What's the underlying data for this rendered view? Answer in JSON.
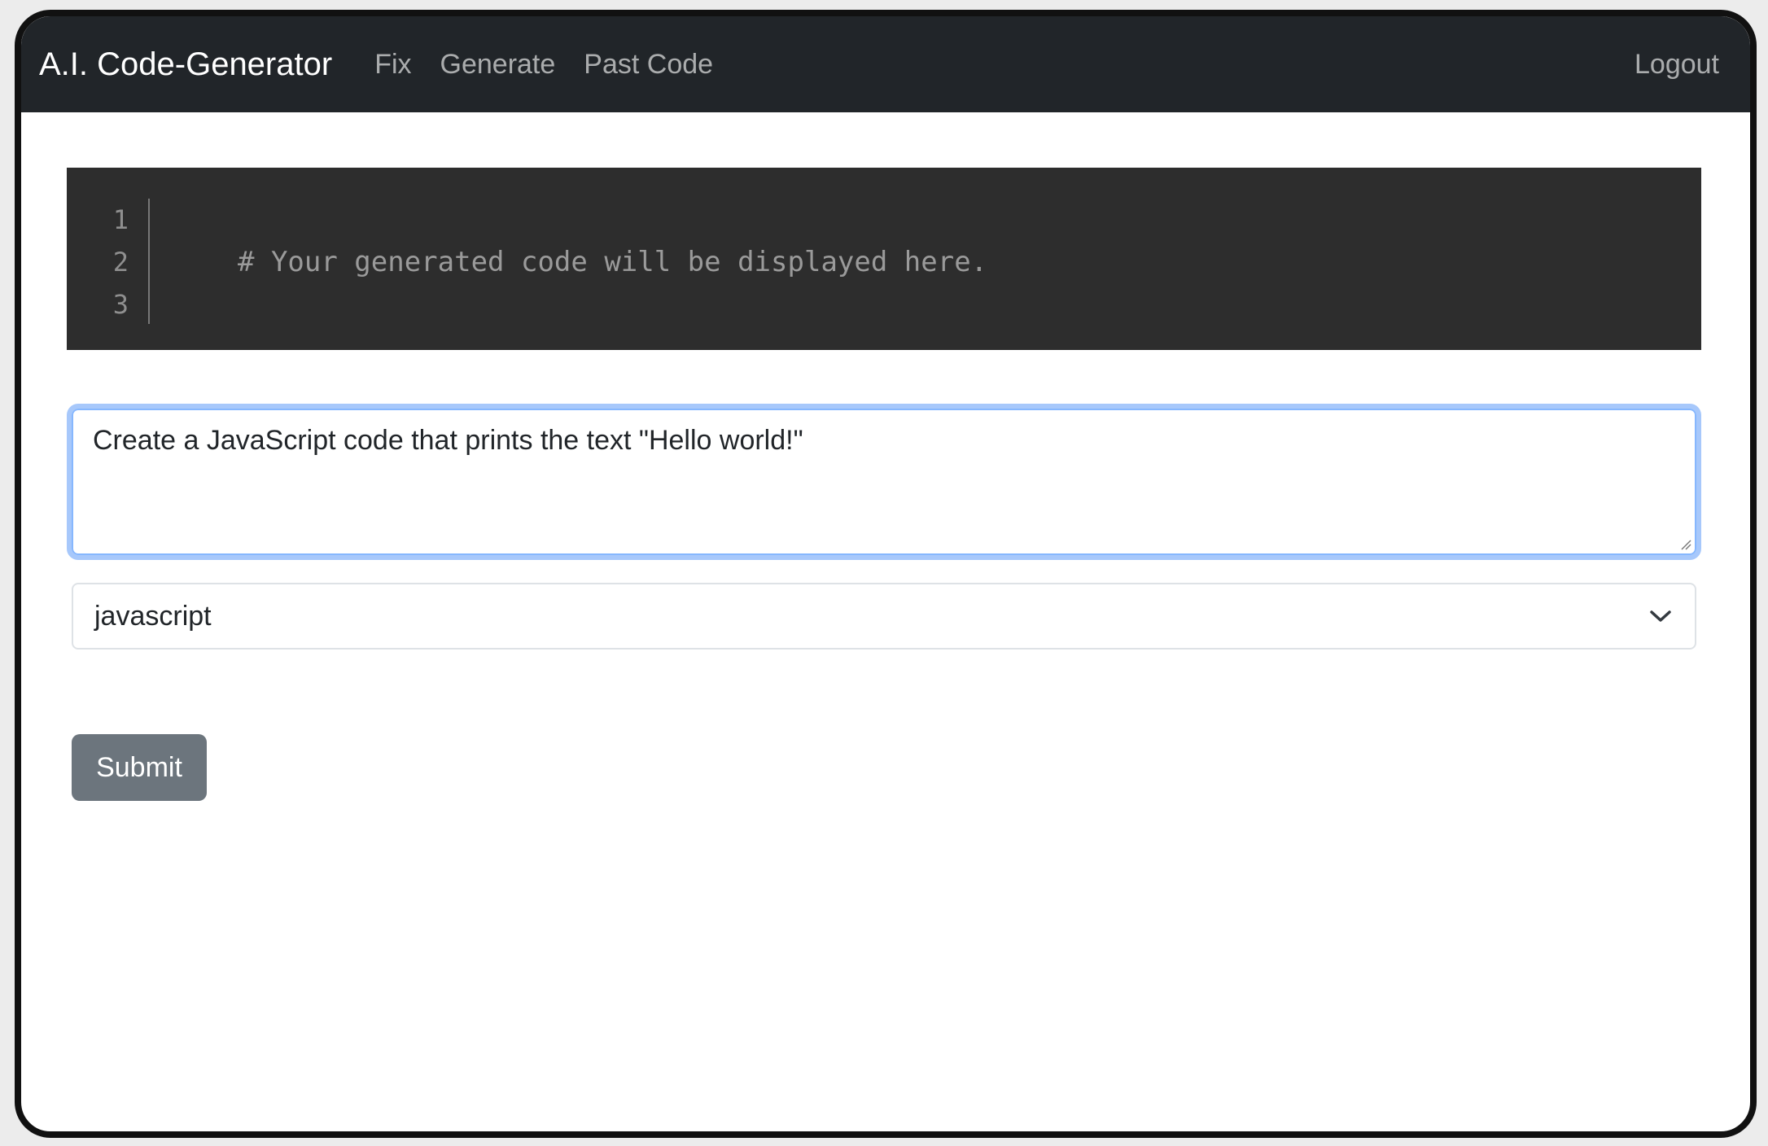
{
  "navbar": {
    "brand": "A.I. Code-Generator",
    "links": [
      "Fix",
      "Generate",
      "Past Code"
    ],
    "logout": "Logout"
  },
  "code_view": {
    "line_numbers": [
      "1",
      "2",
      "3"
    ],
    "lines": [
      "",
      "# Your generated code will be displayed here.",
      ""
    ]
  },
  "prompt": {
    "value": "Create a JavaScript code that prints the text \"Hello world!\""
  },
  "language_select": {
    "selected": "javascript"
  },
  "submit_label": "Submit",
  "colors": {
    "navbar_bg": "#212529",
    "code_bg": "#2d2d2d",
    "submit_bg": "#6c757d",
    "focus_ring": "#86b7fe"
  }
}
